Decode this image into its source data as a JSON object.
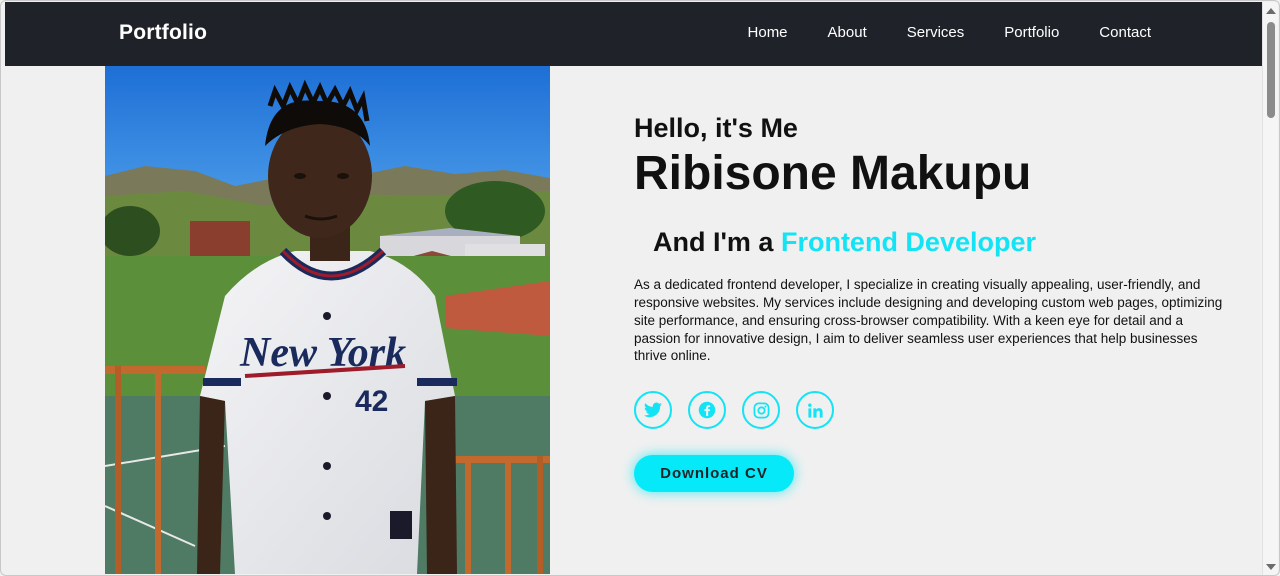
{
  "header": {
    "logo": "Portfolio",
    "nav": [
      "Home",
      "About",
      "Services",
      "Portfolio",
      "Contact"
    ]
  },
  "hero": {
    "greeting": "Hello, it's Me",
    "name": "Ribisone Makupu",
    "role_prefix": "And I'm a",
    "role_highlight": "Frontend Developer",
    "bio": "As a dedicated frontend developer, I specialize in creating visually appealing, user-friendly, and responsive websites. My services include designing and developing custom web pages, optimizing site performance, and ensuring cross-browser compatibility. With a keen eye for detail and a passion for innovative design, I aim to deliver seamless user experiences that help businesses thrive online.",
    "socials": [
      "twitter-icon",
      "facebook-icon",
      "instagram-icon",
      "linkedin-icon"
    ],
    "cta": "Download CV"
  },
  "colors": {
    "header_bg": "#1f2329",
    "accent": "#13e4f5",
    "page_bg": "#f0f0f0"
  }
}
